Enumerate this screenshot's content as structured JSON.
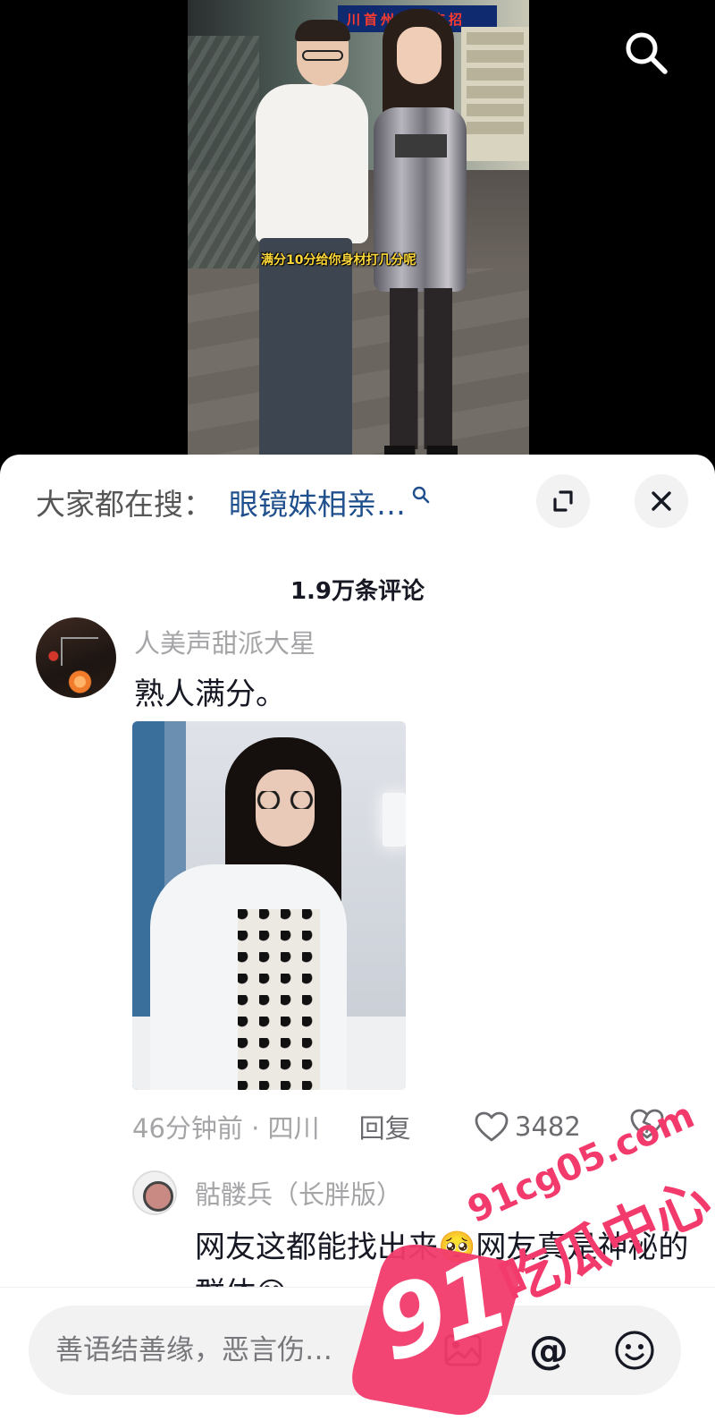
{
  "video": {
    "caption": "满分10分给你身材打几分呢",
    "sign_text": "川首州办面店招"
  },
  "top_bar": {
    "search_icon": "search-icon"
  },
  "sheet": {
    "hot_search": {
      "prefix": "大家都在搜：",
      "query": "眼镜妹相亲…",
      "query_icon": "search-icon",
      "query_color": "#1f4f8d"
    },
    "expand_icon": "expand-icon",
    "close_icon": "close-icon",
    "comment_count": "1.9万条评论"
  },
  "comment": {
    "nickname": "人美声甜派大星",
    "text": "熟人满分。",
    "time_location": "46分钟前 · 四川",
    "reply_label": "回复",
    "like_count": "3482",
    "like_icon": "heart-icon",
    "dislike_icon": "broken-heart-icon"
  },
  "reply": {
    "nickname": "骷髅兵（长胖版）",
    "text": "网友这都能找出来🥺网友真是神秘的群体😄"
  },
  "input": {
    "placeholder": "善语结善缘，恶言伤…",
    "image_icon": "image-icon",
    "at_label": "@",
    "emoji_icon": "emoji-icon"
  },
  "watermark": {
    "number": "91",
    "url": "91cg05.com",
    "name": "吃瓜中心",
    "color": "#f23b6c"
  }
}
